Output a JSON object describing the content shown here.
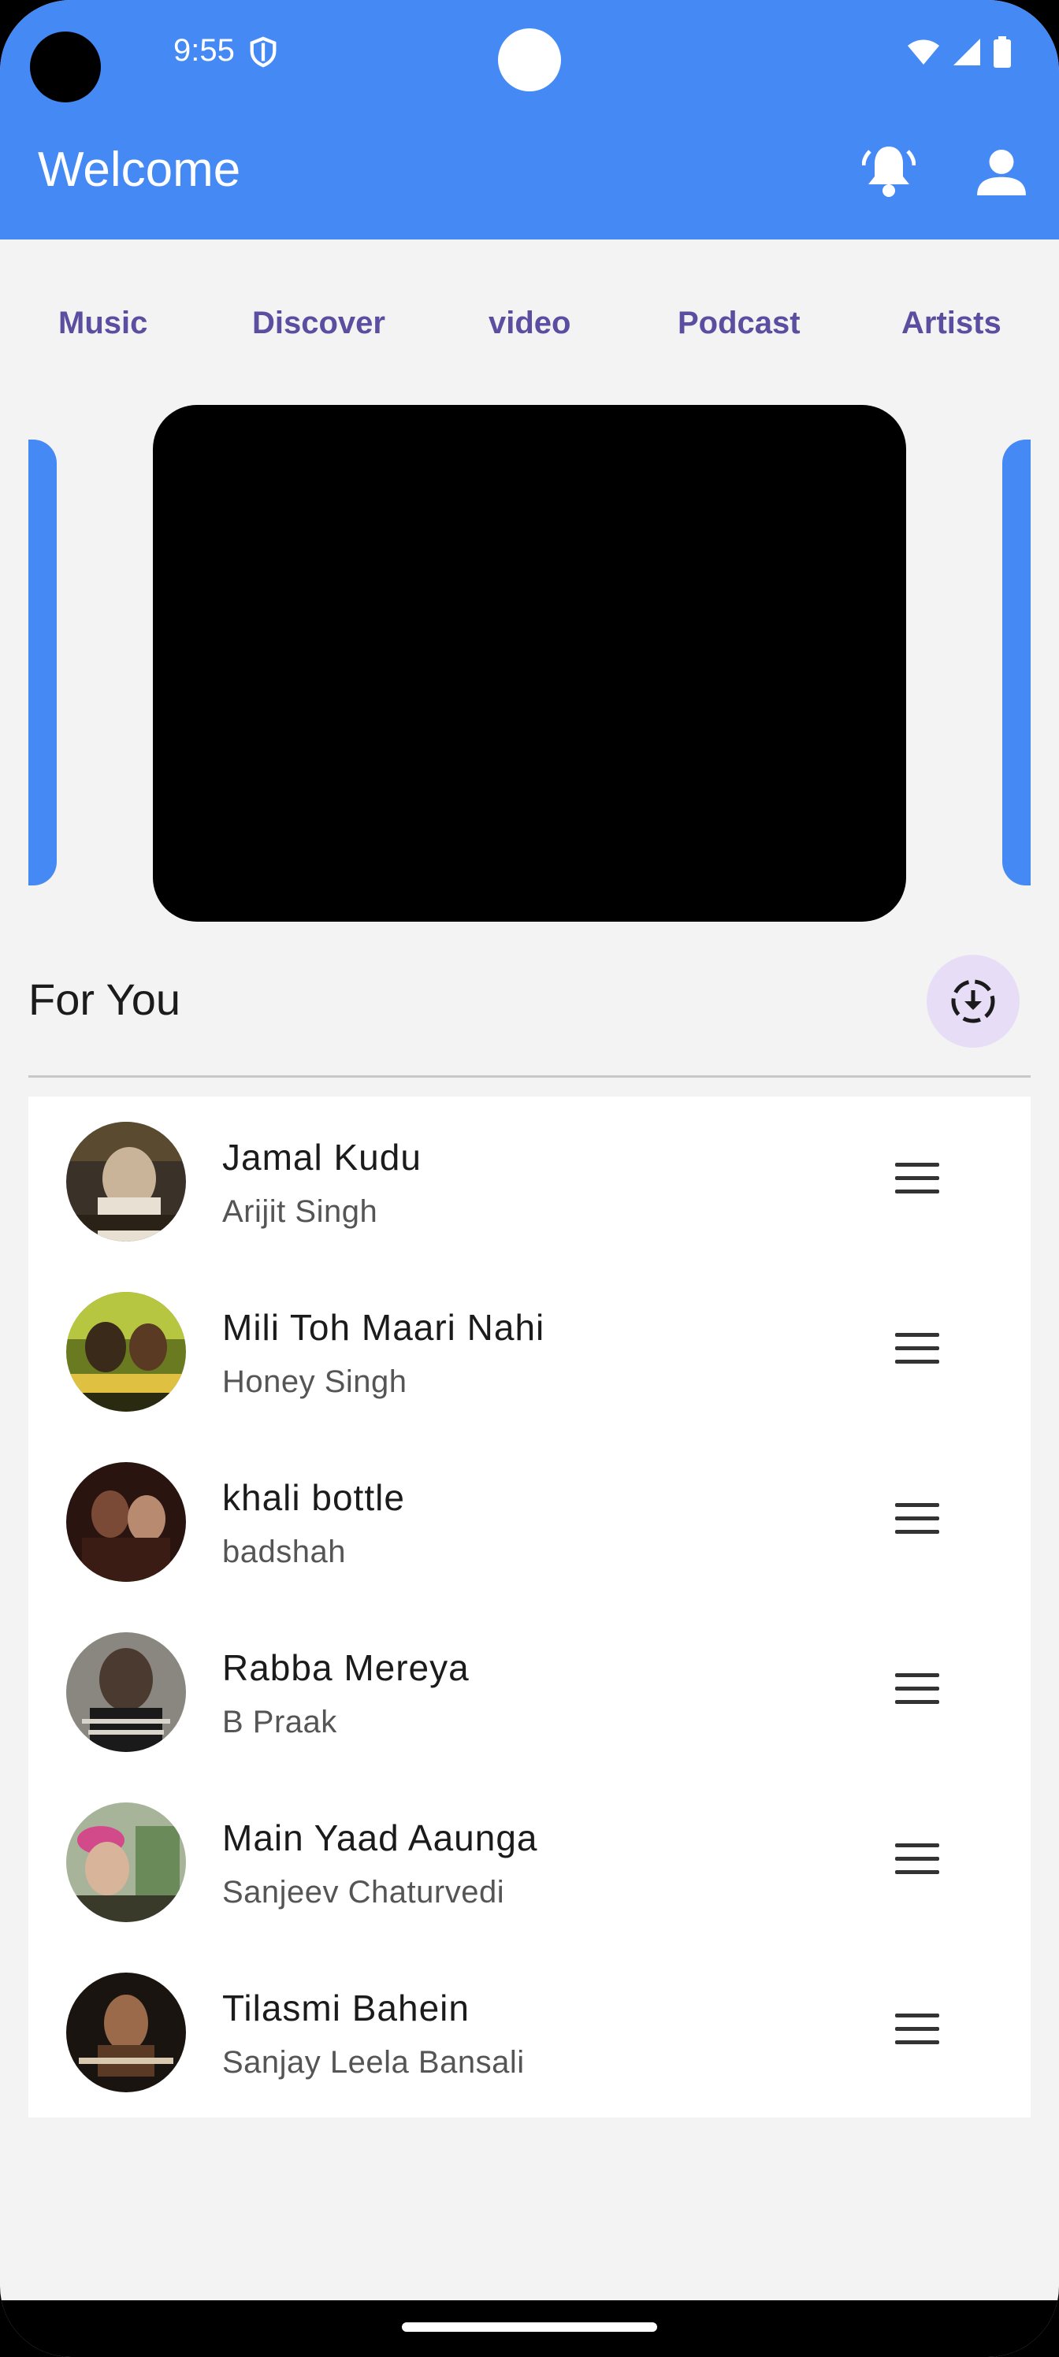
{
  "status_bar": {
    "time": "9:55"
  },
  "app_bar": {
    "title": "Welcome"
  },
  "tabs": [
    {
      "label": "Music"
    },
    {
      "label": "Discover"
    },
    {
      "label": "video"
    },
    {
      "label": "Podcast"
    },
    {
      "label": "Artists"
    }
  ],
  "section": {
    "title": "For You"
  },
  "songs": [
    {
      "title": "Jamal Kudu",
      "artist": "Arijit Singh"
    },
    {
      "title": "Mili Toh Maari Nahi",
      "artist": "Honey Singh"
    },
    {
      "title": "khali bottle",
      "artist": "badshah"
    },
    {
      "title": "Rabba Mereya",
      "artist": "B Praak"
    },
    {
      "title": "Main Yaad Aaunga",
      "artist": "Sanjeev Chaturvedi"
    },
    {
      "title": "Tilasmi Bahein",
      "artist": "Sanjay Leela Bansali"
    }
  ],
  "colors": {
    "primary": "#4589f5",
    "tab_text": "#5b4ea0",
    "download_bg": "#e8ddf7"
  },
  "icons": {
    "notifications": "notification-bell-icon",
    "profile": "person-icon",
    "download": "download-circle-icon",
    "menu": "hamburger-menu-icon"
  }
}
